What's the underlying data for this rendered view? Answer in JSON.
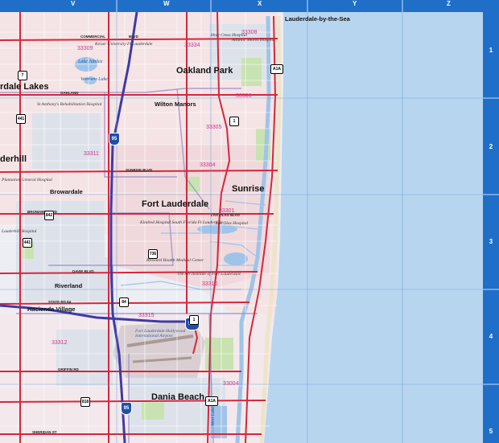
{
  "grid": {
    "columns": [
      "V",
      "W",
      "X",
      "Y",
      "Z"
    ],
    "rows": [
      "1",
      "2",
      "3",
      "4",
      "5"
    ]
  },
  "cities": {
    "oakland_park": "Oakland Park",
    "wilton_manors": "Wilton Manors",
    "fort_lauderdale": "Fort Lauderdale",
    "sunrise": "Sunrise",
    "lauderdale_lakes": "rdale Lakes",
    "lauderhill": "derhill",
    "browardale": "Browardale",
    "riverland": "Riverland",
    "hacienda_village": "Hacienda Village",
    "dania_beach": "Dania Beach",
    "lauderdale_by_the_sea": "Lauderdale-by-the-Sea"
  },
  "zip_codes": [
    "33308",
    "33309",
    "33334",
    "33306",
    "33305",
    "33311",
    "33304",
    "33301",
    "33316",
    "33315",
    "33312",
    "33004"
  ],
  "water_labels": {
    "lake_jabilee": "Lake Jabilee",
    "veterans_lake": "Veterans Lake",
    "port_everglades": "West Lake"
  },
  "poi": {
    "holy_cross": "Holy Cross Hospital",
    "atlantic_shores": "Atlantic Shores Hospital",
    "nova": "Keiser University Ft Lauderdale",
    "st_anthony": "St Anthony's Rehabilitation Hospital",
    "plantation_gen": "Plantation General Hospital",
    "broward_health": "Broward Health Medical Center",
    "kindred": "Kindred Hospital South Florida Ft Lauderdale",
    "la_lauderdale": "Las Olas Hospital",
    "fla_inst": "The Art Institute of Fort Lauderdale",
    "airport": "Fort Lauderdale-Hollywood International Airport",
    "lauderhill_hosp": "Lauderhill Hospital"
  },
  "streets": {
    "commercial": "COMMERCIAL",
    "oakland": "OAKLAND",
    "sunrise_blvd": "SUNRISE BLVD",
    "broward_blvd": "BROWARD BLVD",
    "las_olas": "LAS OLAS BLVD",
    "griffin": "GRIFFIN RD",
    "state_rd_84": "STATE RD 84",
    "sheridan": "SHERIDAN ST",
    "davie": "DAVIE BLVD",
    "blvd": "BLVD"
  },
  "shields": {
    "i95_a": "95",
    "i95_b": "95",
    "i595": "595",
    "us1_a": "1",
    "us1_b": "1",
    "a1a_a": "A1A",
    "a1a_b": "A1A",
    "r441_a": "441",
    "r441_b": "441",
    "r842": "842",
    "r736": "736",
    "r84": "84",
    "r818": "818",
    "r7": "7"
  },
  "colors": {
    "ocean": "#b8d5ef",
    "urban": "#f3e1e4",
    "residential": "#e9ecf2",
    "park": "#c8e3b1",
    "major_road": "#d6263c",
    "interstate": "#3f3aa6",
    "grid_blue": "#1f6fc9",
    "zip_boundary": "#9a8cc9"
  }
}
